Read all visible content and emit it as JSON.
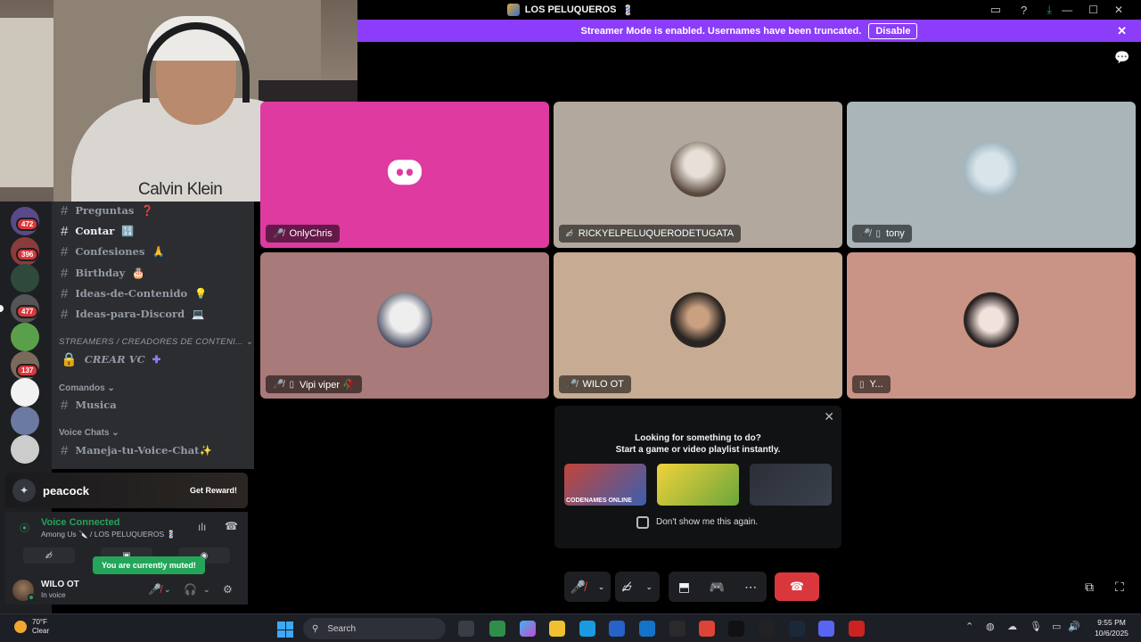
{
  "window": {
    "title": "LOS PELUQUEROS",
    "title_emoji": "💈"
  },
  "banner": {
    "message": "Streamer Mode is enabled. Usernames have been truncated.",
    "disable_label": "Disable"
  },
  "webcam": {
    "shirt_brand": "Calvin Klein"
  },
  "rail": {
    "badges": [
      "472",
      "396",
      "477",
      "137"
    ]
  },
  "channels": {
    "items": [
      {
        "label": "Preguntas",
        "emoji": "❓",
        "active": false
      },
      {
        "label": "Contar",
        "emoji": "🔢",
        "active": true
      },
      {
        "label": "Confesiones",
        "emoji": "🙏",
        "active": false
      },
      {
        "label": "Birthday",
        "emoji": "🎂",
        "active": false
      },
      {
        "label": "Ideas-de-Contenido",
        "emoji": "💡",
        "active": false
      },
      {
        "label": "Ideas-para-Discord",
        "emoji": "💻",
        "active": false
      }
    ],
    "category_streamers": "STREAMERS / CREADORES DE CONTENI...",
    "crear_vc": "CREAR VC",
    "category_comandos": "Comandos",
    "musica": "Musica",
    "category_voice": "Voice Chats",
    "maneja": "Maneja-tu-Voice-Chat✨"
  },
  "ad": {
    "brand": "peacock",
    "cta": "Get Reward!"
  },
  "voice": {
    "status": "Voice Connected",
    "channel": "Among Us 🔪 / LOS PELUQUEROS 💈",
    "tooltip": "You are currently muted!"
  },
  "user": {
    "name": "WILO OT",
    "status": "In voice"
  },
  "tiles": [
    {
      "name": "OnlyChris",
      "color": "#de3aa0",
      "icons": "🎤̸ ▯"
    },
    {
      "name": "RICKYELPELUQUERODETUGATA",
      "color": "#b3a89d",
      "icons": "🎤̸"
    },
    {
      "name": "tony",
      "color": "#a9b5b8",
      "icons": "🎤̸ ▯"
    },
    {
      "name": "Vipi viper 🥀",
      "color": "#a87a79",
      "icons": "🎤̸ ▯"
    },
    {
      "name": "WILO OT",
      "color": "#c7ab93",
      "icons": "🎤̸"
    },
    {
      "name": "Y...",
      "color": "#c99386",
      "icons": "▯"
    }
  ],
  "popup": {
    "line1": "Looking for something to do?",
    "line2": "Start a game or video playlist instantly.",
    "games": [
      "CODENAMES ONLINE",
      "",
      ""
    ],
    "checkbox_label": "Don't show me this again."
  },
  "taskbar": {
    "temp": "70°F",
    "weather": "Clear",
    "search": "Search",
    "time": "9:55 PM",
    "date": "10/6/2025"
  },
  "colors": {
    "accent": "#8b3dfa",
    "connected": "#23a55a",
    "danger": "#da373c"
  }
}
